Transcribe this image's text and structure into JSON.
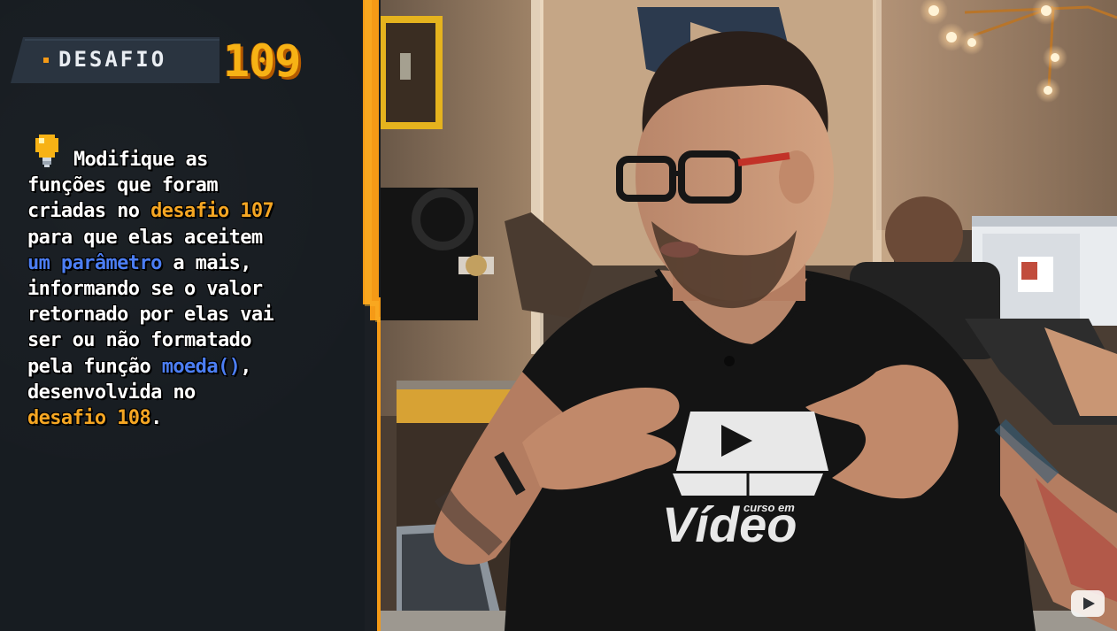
{
  "challenge": {
    "label": "DESAFIO",
    "number": "109",
    "lines": [
      [
        {
          "t": "Modifique as",
          "s": "normal"
        }
      ],
      [
        {
          "t": "funções que foram",
          "s": "normal"
        }
      ],
      [
        {
          "t": "criadas no ",
          "s": "normal"
        },
        {
          "t": "desafio 107",
          "s": "orange"
        }
      ],
      [
        {
          "t": "para que elas aceitem",
          "s": "normal"
        }
      ],
      [
        {
          "t": "um parâmetro",
          "s": "blue"
        },
        {
          "t": " a mais,",
          "s": "normal"
        }
      ],
      [
        {
          "t": "informando se o valor",
          "s": "normal"
        }
      ],
      [
        {
          "t": "retornado por elas vai",
          "s": "normal"
        }
      ],
      [
        {
          "t": "ser ou não formatado",
          "s": "normal"
        }
      ],
      [
        {
          "t": "pela função ",
          "s": "normal"
        },
        {
          "t": "moeda()",
          "s": "blue"
        },
        {
          "t": ",",
          "s": "normal"
        }
      ],
      [
        {
          "t": "desenvolvida no",
          "s": "normal"
        }
      ],
      [
        {
          "t": "desafio 108",
          "s": "orange"
        },
        {
          "t": ".",
          "s": "normal"
        }
      ]
    ]
  },
  "shirt": {
    "small_text": "curso em",
    "big_text": "Vídeo"
  },
  "icons": {
    "tip": "lightbulb-icon",
    "player": "youtube-logo-icon"
  },
  "colors": {
    "accent_orange": "#f5a623",
    "accent_blue": "#4c7ef3",
    "panel_bg": "#171c21",
    "border_orange": "#f59a16"
  }
}
